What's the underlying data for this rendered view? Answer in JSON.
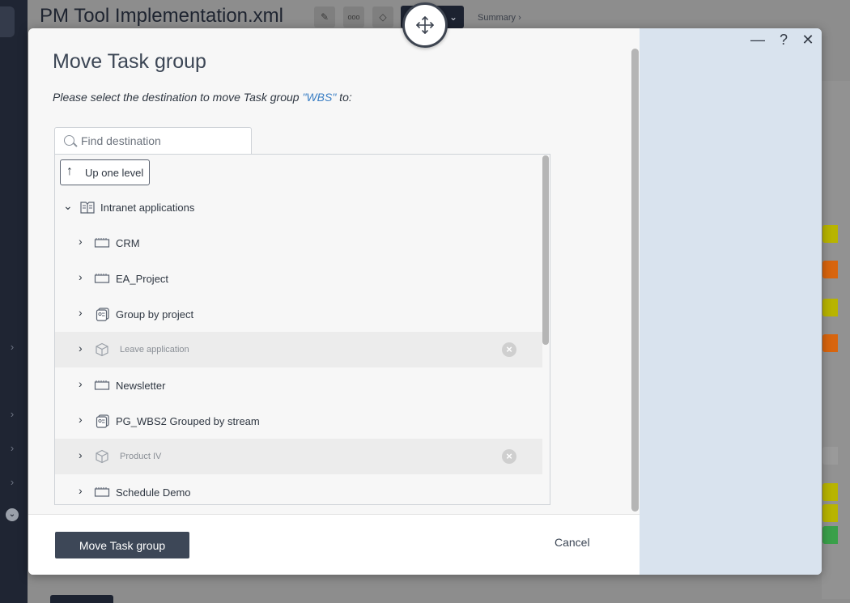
{
  "background": {
    "title": "PM Tool Implementation.xml",
    "tools": [
      "✎",
      "ooo",
      "◇"
    ],
    "summary_link": "Summary ›",
    "swatches": [
      "#b8b400",
      "#d8650e",
      "#b8b400",
      "#d8650e",
      "#9a9a9a",
      "#b8b400",
      "#b8b400",
      "#3aa04a"
    ]
  },
  "dialog": {
    "title": "Move Task group",
    "subtitle_prefix": "Please select the destination to move Task group ",
    "subtitle_item": "\"WBS\"",
    "subtitle_suffix": " to:",
    "window_controls": {
      "minimize": "—",
      "help": "?",
      "close": "✕"
    },
    "search": {
      "placeholder": "Find destination",
      "value": ""
    },
    "up_button": {
      "arrow": "↑",
      "label": "Up one level"
    },
    "tree": {
      "root": {
        "label": "Intranet applications",
        "icon": "folder-book-icon",
        "expanded": true
      },
      "items": [
        {
          "label": "CRM",
          "icon": "project-icon",
          "disabled": false
        },
        {
          "label": "EA_Project",
          "icon": "project-icon",
          "disabled": false
        },
        {
          "label": "Group by project",
          "icon": "group-icon",
          "disabled": false
        },
        {
          "label": "Leave application",
          "icon": "package-icon",
          "disabled": true
        },
        {
          "label": "Newsletter",
          "icon": "project-icon",
          "disabled": false
        },
        {
          "label": "PG_WBS2 Grouped by stream",
          "icon": "group-icon",
          "disabled": false
        },
        {
          "label": "Product IV",
          "icon": "package-icon",
          "disabled": true
        },
        {
          "label": "Schedule Demo",
          "icon": "project-icon",
          "disabled": false
        }
      ]
    },
    "primary_button": "Move Task group",
    "cancel_button": "Cancel"
  },
  "colors": {
    "primary": "#3d4757",
    "link": "#3b7fc4",
    "side_panel": "#d9e3ee"
  }
}
